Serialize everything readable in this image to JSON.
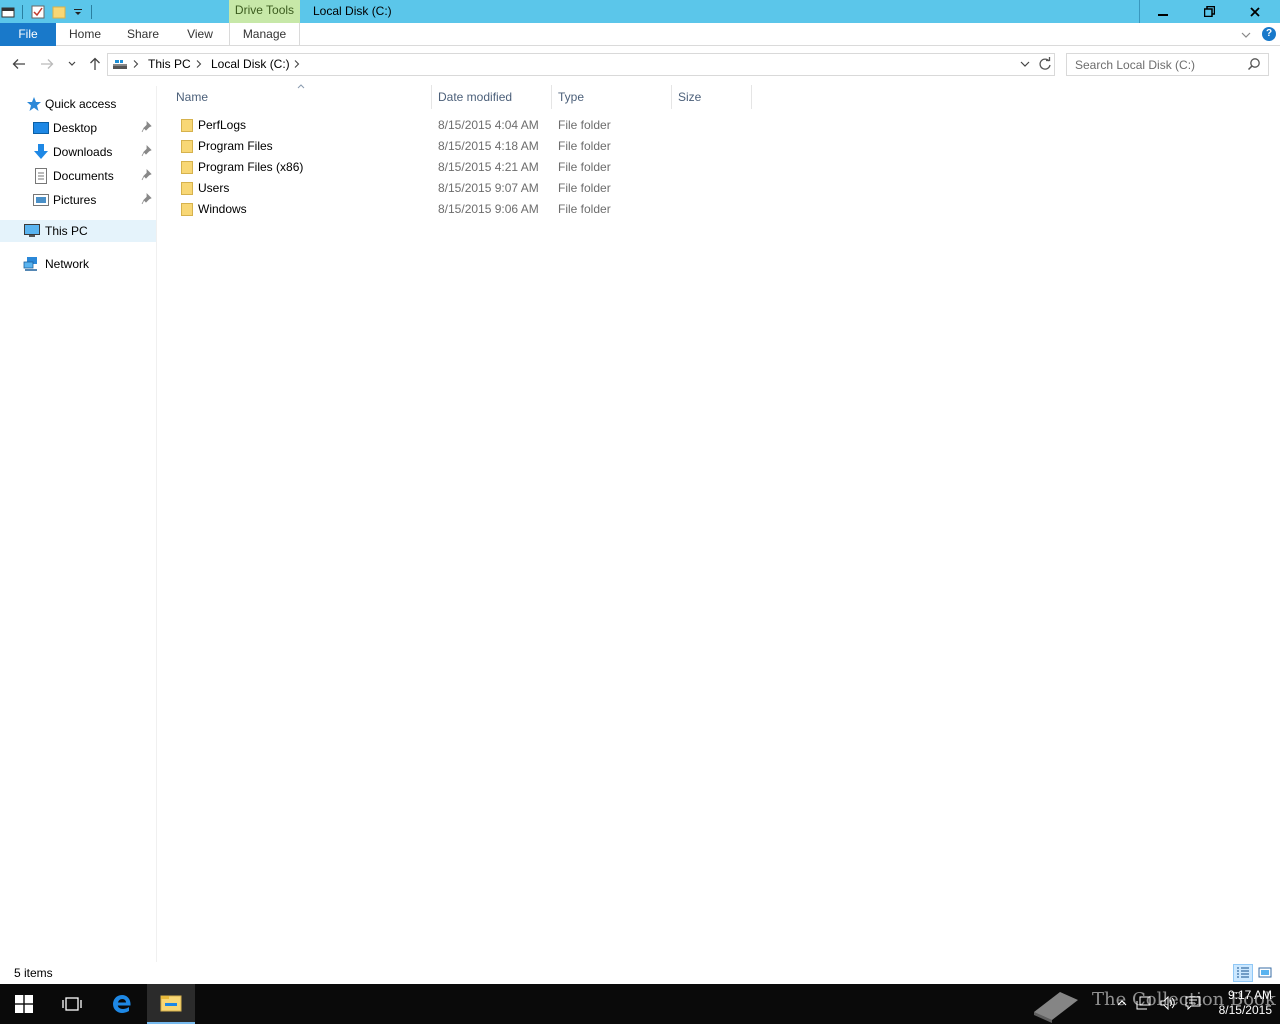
{
  "window": {
    "title": "Local Disk (C:)",
    "contextual_tab_group": "Drive Tools"
  },
  "ribbon": {
    "tabs": [
      "File",
      "Home",
      "Share",
      "View",
      "Manage"
    ]
  },
  "address": {
    "breadcrumbs": [
      "This PC",
      "Local Disk (C:)"
    ]
  },
  "search": {
    "placeholder": "Search Local Disk (C:)"
  },
  "nav_pane": {
    "quick_access": "Quick access",
    "pinned": [
      "Desktop",
      "Downloads",
      "Documents",
      "Pictures"
    ],
    "this_pc": "This PC",
    "network": "Network"
  },
  "file_list": {
    "columns": [
      "Name",
      "Date modified",
      "Type",
      "Size"
    ],
    "rows": [
      {
        "name": "PerfLogs",
        "date": "8/15/2015 4:04 AM",
        "type": "File folder"
      },
      {
        "name": "Program Files",
        "date": "8/15/2015 4:18 AM",
        "type": "File folder"
      },
      {
        "name": "Program Files (x86)",
        "date": "8/15/2015 4:21 AM",
        "type": "File folder"
      },
      {
        "name": "Users",
        "date": "8/15/2015 9:07 AM",
        "type": "File folder"
      },
      {
        "name": "Windows",
        "date": "8/15/2015 9:06 AM",
        "type": "File folder"
      }
    ]
  },
  "status_bar": {
    "item_count": "5 items"
  },
  "taskbar": {
    "time": "9:17 AM",
    "date": "8/15/2015",
    "watermark": "The Collection Book"
  },
  "colors": {
    "title_bar": "#5bc6ea",
    "drive_tools": "#c7e8a8",
    "file_tab": "#1979ca",
    "folder": "#f8d775",
    "selection": "#e5f3fb",
    "taskbar": "#0a0a0a"
  },
  "icons": {
    "qat": [
      "explorer-icon",
      "properties-icon",
      "new-folder-icon",
      "customize-qat-icon"
    ],
    "nav": [
      "back-arrow-icon",
      "forward-arrow-icon",
      "recent-locations-icon",
      "up-arrow-icon"
    ],
    "window_controls": [
      "minimize-icon",
      "restore-icon",
      "close-icon"
    ],
    "taskbar": [
      "windows-start-icon",
      "task-view-icon",
      "edge-icon",
      "file-explorer-icon"
    ]
  }
}
